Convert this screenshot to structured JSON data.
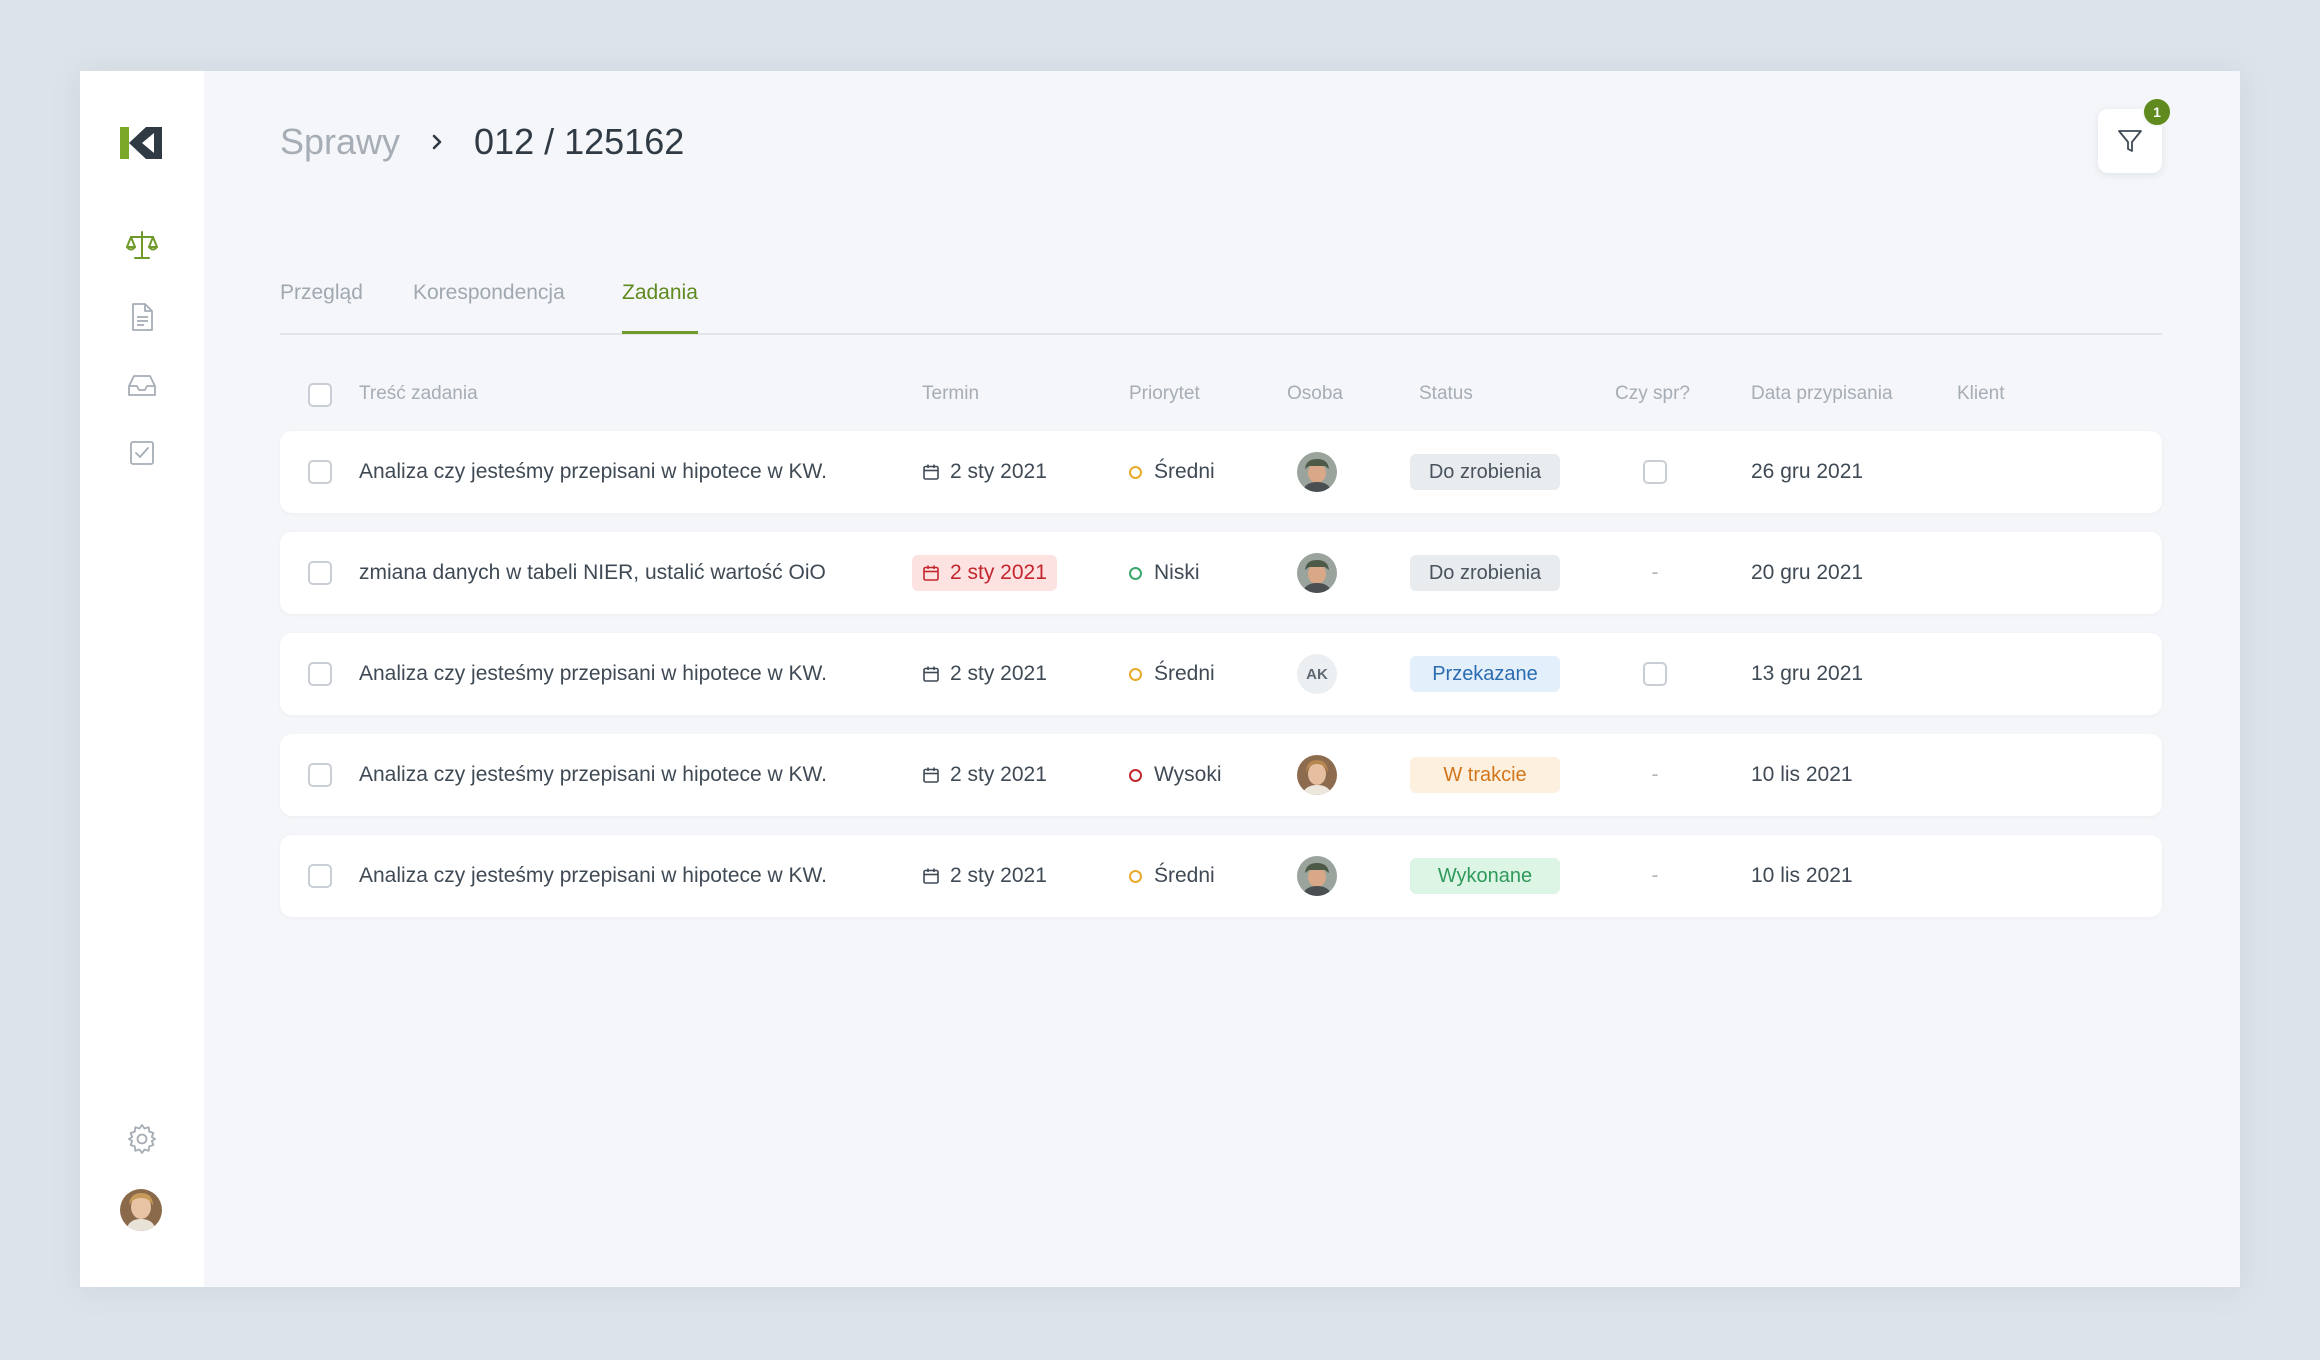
{
  "breadcrumb": {
    "root": "Sprawy",
    "current": "012 / 125162"
  },
  "filter": {
    "badge_count": "1"
  },
  "tabs": [
    {
      "label": "Przegląd"
    },
    {
      "label": "Korespondencja"
    },
    {
      "label": "Zadania",
      "active": true
    }
  ],
  "columns": {
    "task": "Treść zadania",
    "due": "Termin",
    "priority": "Priorytet",
    "person": "Osoba",
    "status": "Status",
    "checked": "Czy spr?",
    "assigned": "Data przypisania",
    "client": "Klient"
  },
  "colors": {
    "accent": "#5f8a1e",
    "priority_medium": "#e9a92a",
    "priority_low": "#3aa76d",
    "priority_high": "#c4262e"
  },
  "rows": [
    {
      "task": "Analiza czy jesteśmy przepisani w hipotece w KW.",
      "due": "2 sty 2021",
      "overdue": false,
      "priority": "Średni",
      "priority_level": "medium",
      "person": "avatar-man",
      "status": "Do zrobienia",
      "status_kind": "todo",
      "checked": "checkbox",
      "assigned": "26 gru 2021"
    },
    {
      "task": "zmiana danych w tabeli NIER, ustalić wartość OiO",
      "due": "2 sty 2021",
      "overdue": true,
      "priority": "Niski",
      "priority_level": "low",
      "person": "avatar-man",
      "status": "Do zrobienia",
      "status_kind": "todo",
      "checked": "-",
      "assigned": "20 gru 2021"
    },
    {
      "task": "Analiza czy jesteśmy przepisani w hipotece w KW.",
      "due": "2 sty 2021",
      "overdue": false,
      "priority": "Średni",
      "priority_level": "medium",
      "person": "AK",
      "status": "Przekazane",
      "status_kind": "transferred",
      "checked": "checkbox",
      "assigned": "13 gru 2021"
    },
    {
      "task": "Analiza czy jesteśmy przepisani w hipotece w KW.",
      "due": "2 sty 2021",
      "overdue": false,
      "priority": "Wysoki",
      "priority_level": "high",
      "person": "avatar-woman",
      "status": "W trakcie",
      "status_kind": "inprogress",
      "checked": "-",
      "assigned": "10 lis 2021"
    },
    {
      "task": "Analiza czy jesteśmy przepisani w hipotece w KW.",
      "due": "2 sty 2021",
      "overdue": false,
      "priority": "Średni",
      "priority_level": "medium",
      "person": "avatar-man",
      "status": "Wykonane",
      "status_kind": "done",
      "checked": "-",
      "assigned": "10 lis 2021"
    }
  ],
  "sidebar": {
    "items": [
      {
        "icon": "scales-icon",
        "active": true
      },
      {
        "icon": "document-icon"
      },
      {
        "icon": "inbox-icon"
      },
      {
        "icon": "checkbox-task-icon"
      }
    ],
    "bottom": [
      {
        "icon": "gear-icon"
      },
      {
        "icon": "user-avatar"
      }
    ]
  }
}
